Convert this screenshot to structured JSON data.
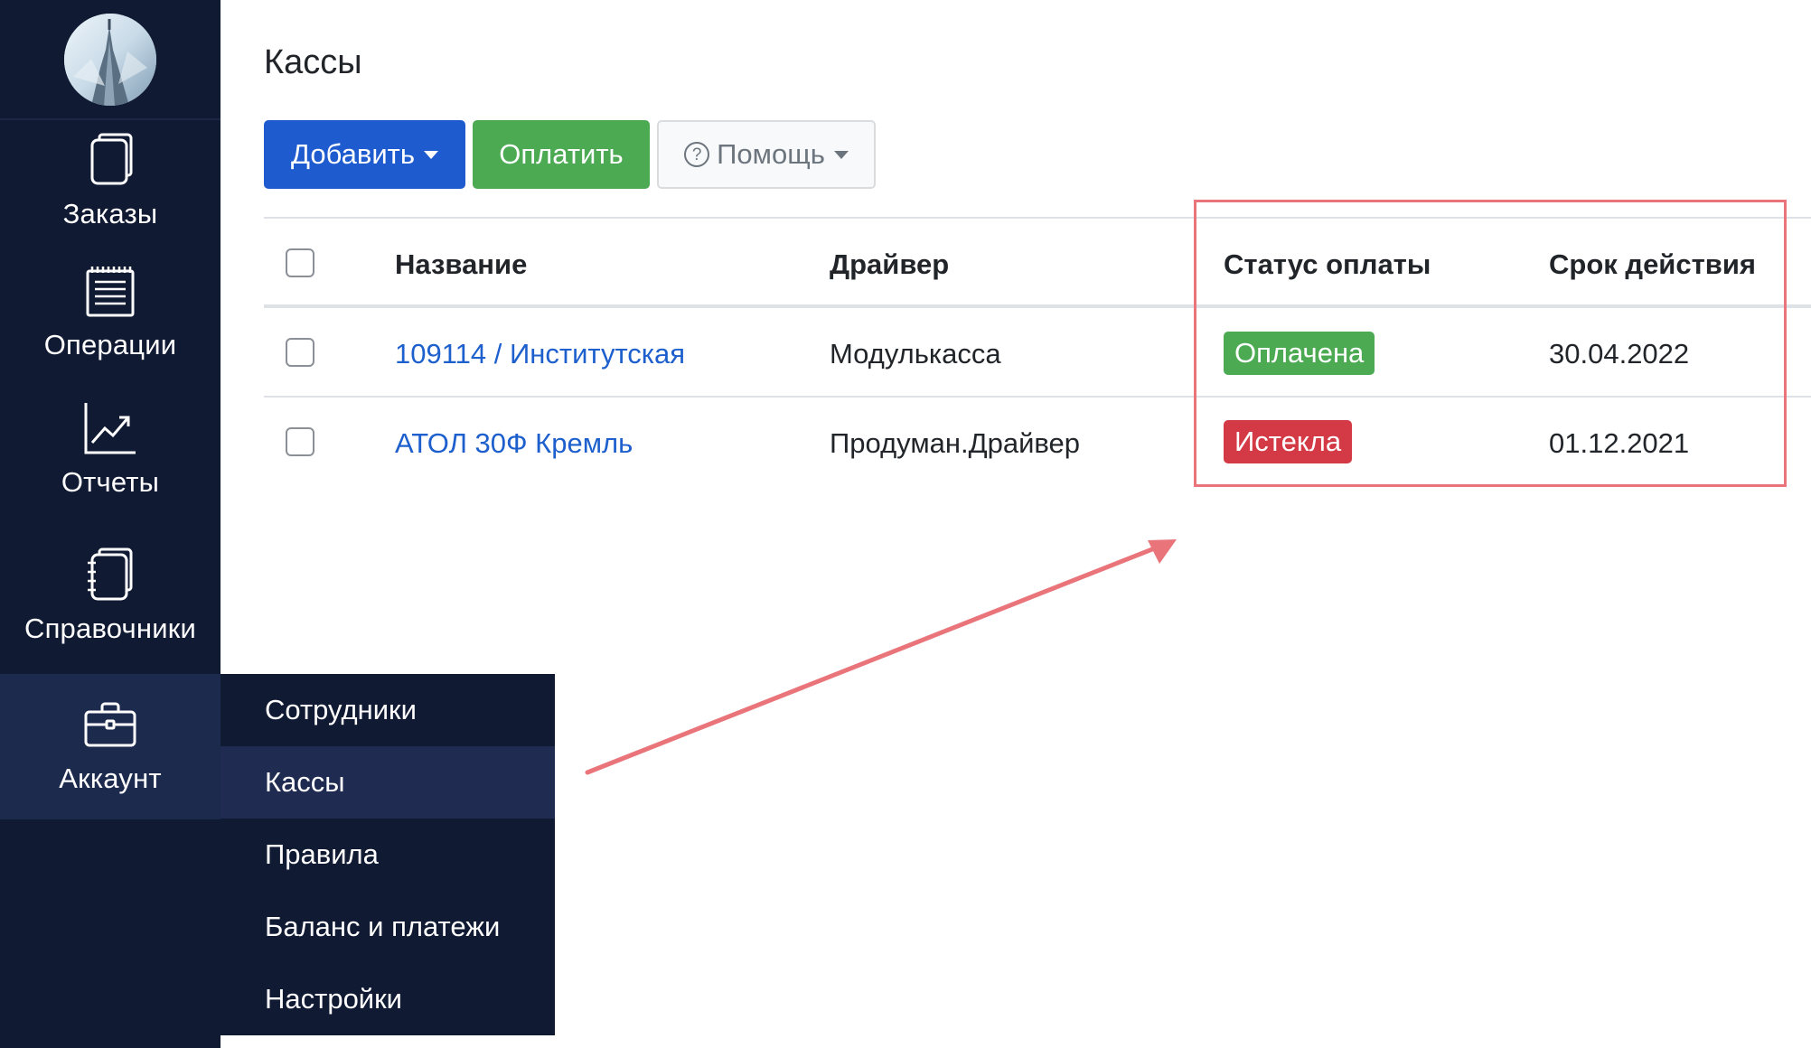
{
  "sidebar": {
    "items": [
      {
        "label": "Заказы",
        "icon": "orders-icon"
      },
      {
        "label": "Операции",
        "icon": "operations-icon"
      },
      {
        "label": "Отчеты",
        "icon": "reports-chart-icon"
      },
      {
        "label": "Справочники",
        "icon": "notebook-icon"
      },
      {
        "label": "Аккаунт",
        "icon": "briefcase-icon"
      }
    ],
    "submenu": [
      {
        "label": "Сотрудники"
      },
      {
        "label": "Кассы"
      },
      {
        "label": "Правила"
      },
      {
        "label": "Баланс и платежи"
      },
      {
        "label": "Настройки"
      }
    ]
  },
  "page": {
    "title": "Кассы"
  },
  "toolbar": {
    "add_label": "Добавить",
    "pay_label": "Оплатить",
    "help_label": "Помощь",
    "help_icon_glyph": "?"
  },
  "table": {
    "headers": {
      "name": "Название",
      "driver": "Драйвер",
      "payment_status": "Статус оплаты",
      "expiry": "Срок действия"
    },
    "rows": [
      {
        "name": "109114 / Институтская",
        "driver": "Модулькасса",
        "status": "Оплачена",
        "status_color": "#4caa53",
        "expiry": "30.04.2022"
      },
      {
        "name": "АТОЛ 30Ф Кремль",
        "driver": "Продуман.Драйвер",
        "status": "Истекла",
        "status_color": "#d33a45",
        "expiry": "01.12.2021"
      }
    ]
  },
  "colors": {
    "sidebar_bg": "#111a33",
    "primary": "#1e5bce",
    "success": "#4caa53",
    "danger": "#d33a45",
    "link": "#1d5fcd",
    "annotation": "#e9747a"
  }
}
